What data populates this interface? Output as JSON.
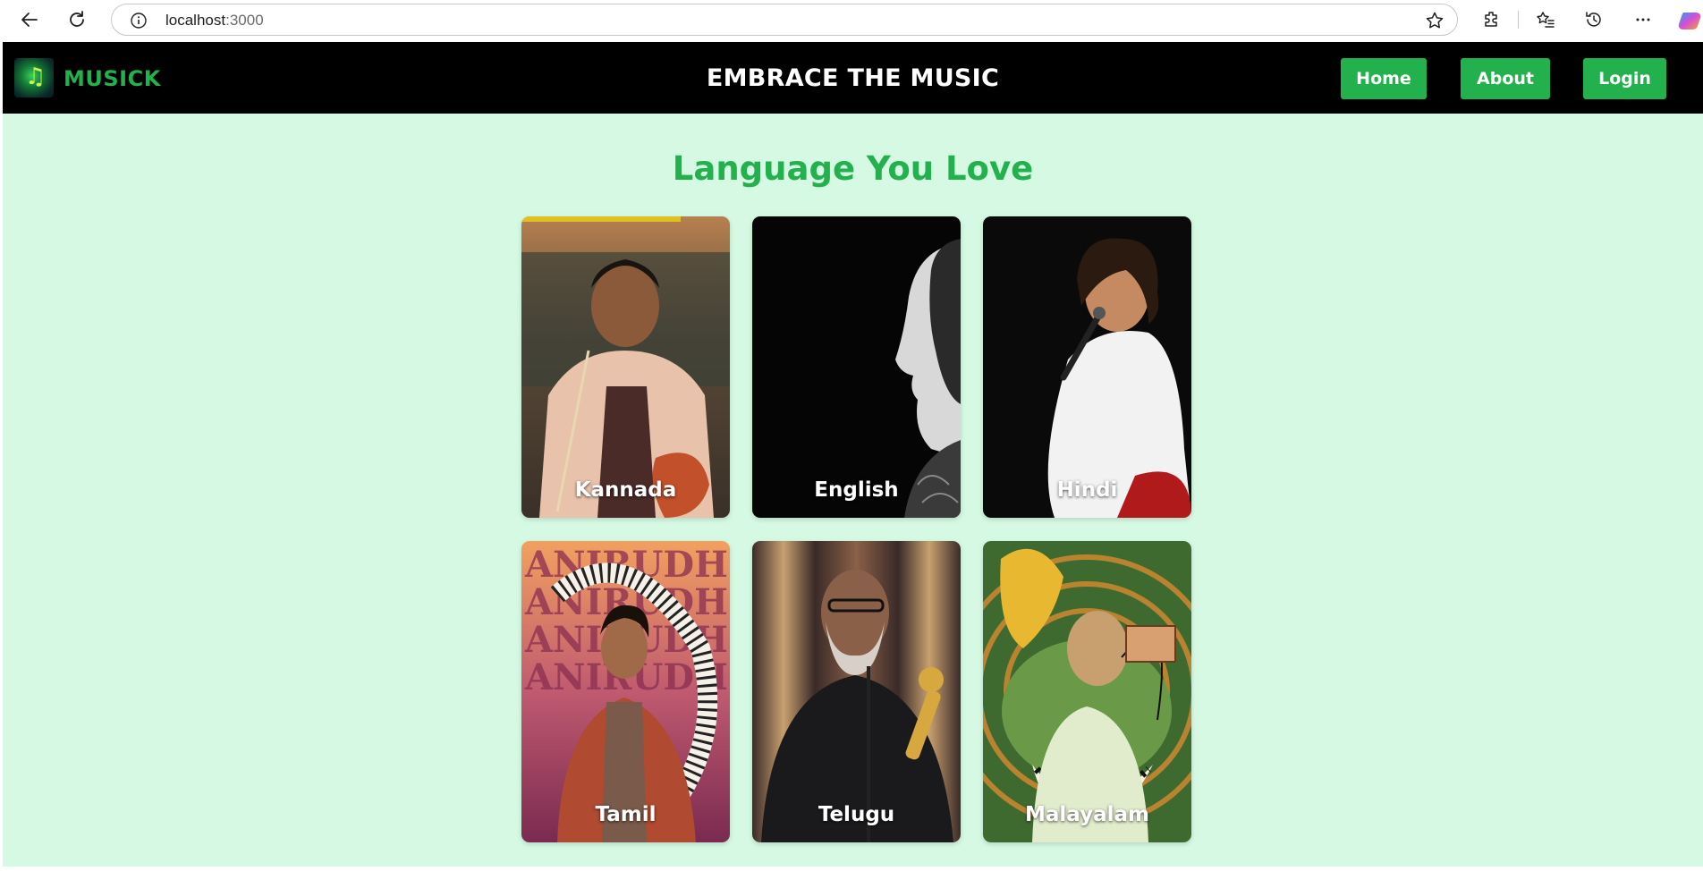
{
  "browser": {
    "url_host": "localhost",
    "url_port": ":3000",
    "icons": [
      "back-icon",
      "reload-icon",
      "info-icon",
      "star-icon",
      "extensions-icon",
      "favorites-icon",
      "history-icon",
      "more-icon",
      "copilot-icon"
    ]
  },
  "header": {
    "brand": "MUSICK",
    "tagline": "EMBRACE THE MUSIC",
    "nav": [
      {
        "label": "Home"
      },
      {
        "label": "About"
      },
      {
        "label": "Login"
      }
    ],
    "accent": "#22b14c"
  },
  "main": {
    "title": "Language You Love",
    "background": "#d5f9e3",
    "cards": [
      {
        "label": "Kannada"
      },
      {
        "label": "English"
      },
      {
        "label": "Hindi"
      },
      {
        "label": "Tamil"
      },
      {
        "label": "Telugu"
      },
      {
        "label": "Malayalam"
      }
    ]
  }
}
